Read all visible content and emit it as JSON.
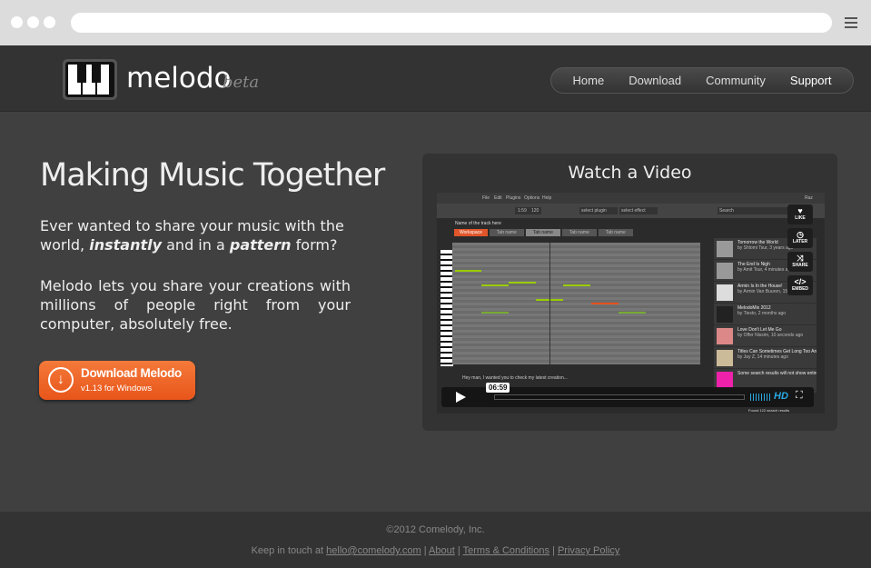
{
  "brand": {
    "name": "melodo",
    "tag": "beta"
  },
  "nav": [
    {
      "label": "Home"
    },
    {
      "label": "Download"
    },
    {
      "label": "Community"
    },
    {
      "label": "Support",
      "active": true
    }
  ],
  "hero": {
    "title": "Making Music Together",
    "p1_a": "Ever wanted to share your music with the world, ",
    "p1_b": "instantly",
    "p1_c": " and in a ",
    "p1_d": "pattern",
    "p1_e": " form?",
    "p2": "Melodo lets you share your creations with millions of people right from your computer, absolutely free."
  },
  "download": {
    "label": "Download Melodo",
    "sub": "v1.13 for Windows",
    "icon": "download-arrow-icon",
    "color": "#ef6a2a"
  },
  "video": {
    "title": "Watch a Video",
    "app": {
      "menu": [
        "File",
        "Edit",
        "Plugins",
        "Options",
        "Help"
      ],
      "user": "Raz",
      "time": "1:59",
      "bpm": "120",
      "plugin": "select plugin",
      "effect": "select effect",
      "search": "Search",
      "track": "Name of the track here",
      "tabs": [
        "Workspace",
        "Tab name",
        "Tab name",
        "Tab name",
        "Tab name"
      ],
      "list": [
        {
          "title": "Tomorrow the World",
          "by": "by Shlomi Tsur, 3 years ago"
        },
        {
          "title": "The End Is Nigh",
          "by": "by Amit Tsur, 4 minutes ago"
        },
        {
          "title": "Armin Is In the House!",
          "by": "by Armin Van Buuren, 15 hours ago"
        },
        {
          "title": "MelodoMix 2012",
          "by": "by Tiesto, 2 months ago"
        },
        {
          "title": "Love Don't Let Me Go",
          "by": "by Offer Nissim, 10 seconds ago"
        },
        {
          "title": "Titles Can Sometimes Get Long Too And...",
          "by": "by Jay Z, 14 minutes ago"
        },
        {
          "title": "Some search results will not show entirely",
          "by": ""
        }
      ],
      "found": "Found 122 search results",
      "comment": "Hey man, I wanted you to check my latest creation..."
    },
    "overlay": [
      "LIKE",
      "LATER",
      "SHARE",
      "EMBED"
    ],
    "timecode": "06:59",
    "hd": "HD"
  },
  "footer": {
    "copyright": "©2012 Comelody, Inc.",
    "keep": "Keep in touch at ",
    "email": "hello@comelody.com",
    "about": "About",
    "terms": "Terms & Conditions",
    "privacy": "Privacy Policy",
    "sep": " | "
  }
}
